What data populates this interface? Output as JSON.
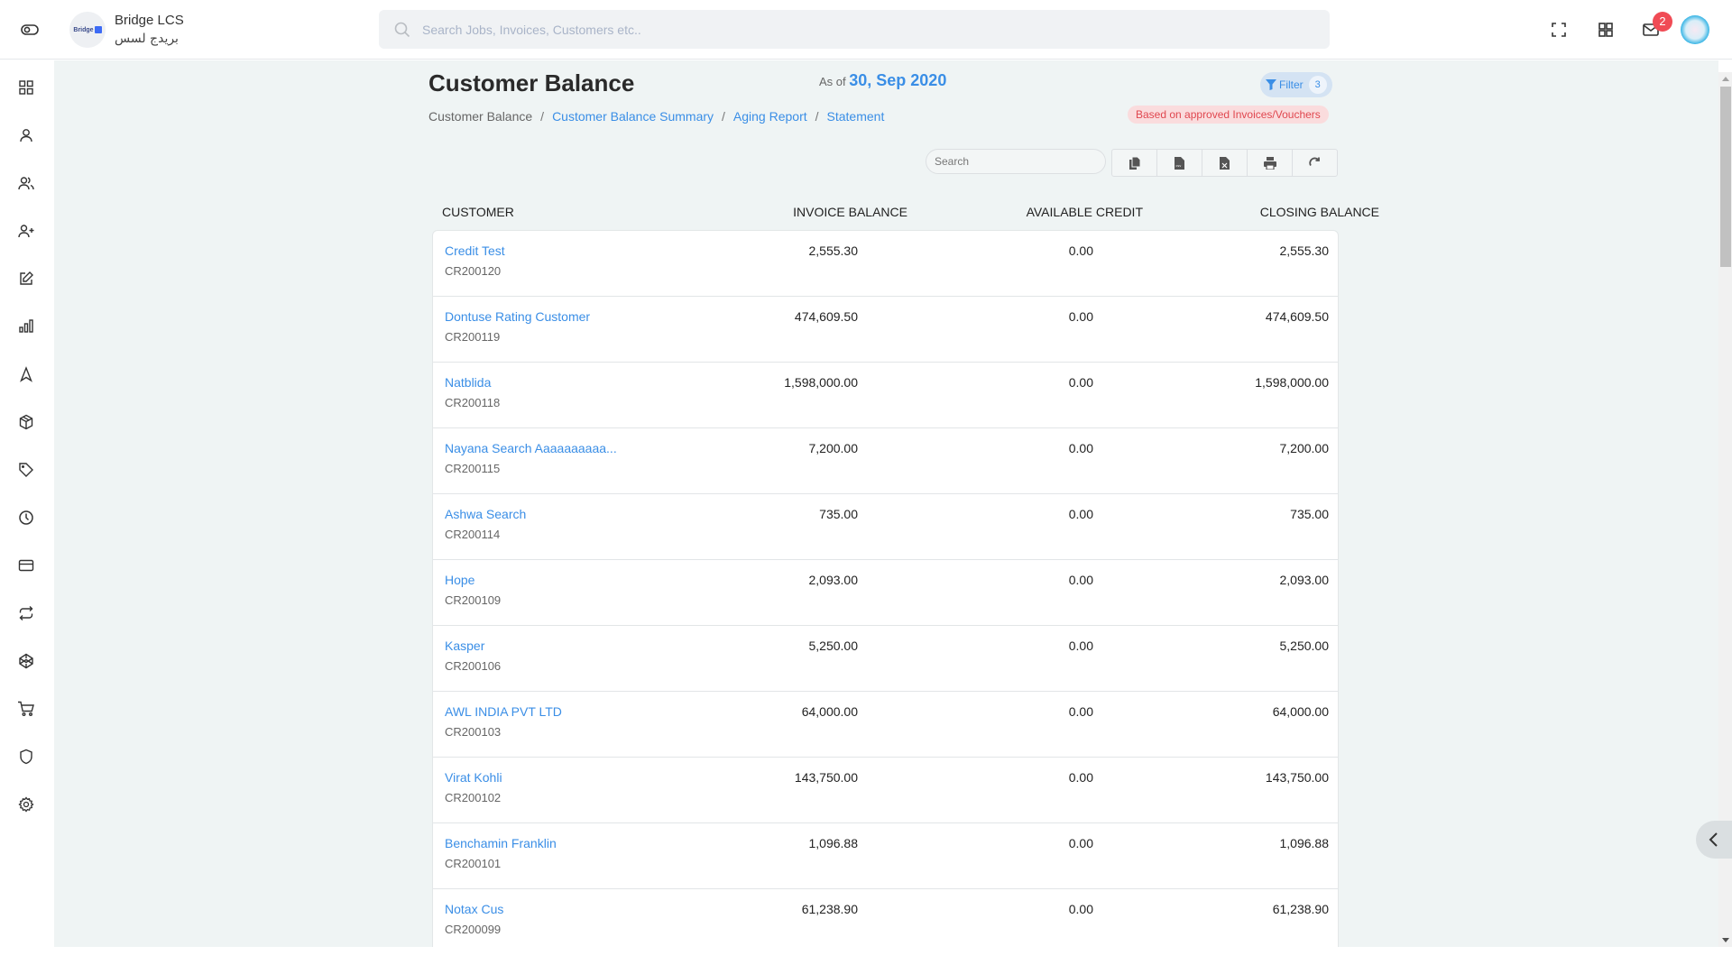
{
  "header": {
    "brand_name": "Bridge LCS",
    "brand_sub": "بريدج لسس",
    "logo_text": "Bridge",
    "search_placeholder": "Search Jobs, Invoices, Customers etc..",
    "notification_count": "2",
    "icons": [
      "toggle-icon",
      "fullscreen-icon",
      "apps-grid-icon",
      "mail-icon",
      "user-avatar"
    ]
  },
  "sidebar": {
    "items": [
      {
        "name": "dashboard",
        "icon": "grid-icon"
      },
      {
        "name": "user",
        "icon": "user-icon"
      },
      {
        "name": "users",
        "icon": "users-icon"
      },
      {
        "name": "add-user",
        "icon": "user-plus-icon"
      },
      {
        "name": "edit",
        "icon": "edit-icon"
      },
      {
        "name": "reports",
        "icon": "bar-chart-icon"
      },
      {
        "name": "navigation",
        "icon": "navigation-icon"
      },
      {
        "name": "packages",
        "icon": "box-icon"
      },
      {
        "name": "tags",
        "icon": "tag-icon"
      },
      {
        "name": "history",
        "icon": "clock-icon"
      },
      {
        "name": "payments",
        "icon": "credit-card-icon"
      },
      {
        "name": "transfers",
        "icon": "repeat-icon"
      },
      {
        "name": "integrations",
        "icon": "codepen-icon"
      },
      {
        "name": "orders",
        "icon": "cart-icon"
      },
      {
        "name": "security",
        "icon": "shield-icon"
      },
      {
        "name": "settings",
        "icon": "gear-icon"
      }
    ]
  },
  "page": {
    "title": "Customer Balance",
    "as_of_label": "As of",
    "as_of_date": "30, Sep 2020",
    "filter_label": "Filter",
    "filter_count": "3",
    "approval_note": "Based on approved Invoices/Vouchers",
    "breadcrumb": {
      "current": "Customer Balance",
      "links": [
        "Customer Balance Summary",
        "Aging Report",
        "Statement"
      ]
    },
    "table_search_placeholder": "Search",
    "tools": [
      "copy-icon",
      "csv-icon",
      "excel-icon",
      "print-icon",
      "refresh-icon"
    ]
  },
  "table": {
    "columns": [
      "CUSTOMER",
      "INVOICE BALANCE",
      "AVAILABLE CREDIT",
      "CLOSING BALANCE"
    ],
    "rows": [
      {
        "name": "Credit Test",
        "code": "CR200120",
        "invoice_balance": "2,555.30",
        "available_credit": "0.00",
        "closing_balance": "2,555.30"
      },
      {
        "name": "Dontuse Rating Customer",
        "code": "CR200119",
        "invoice_balance": "474,609.50",
        "available_credit": "0.00",
        "closing_balance": "474,609.50"
      },
      {
        "name": "Natblida",
        "code": "CR200118",
        "invoice_balance": "1,598,000.00",
        "available_credit": "0.00",
        "closing_balance": "1,598,000.00"
      },
      {
        "name": "Nayana Search Aaaaaaaaaa...",
        "code": "CR200115",
        "invoice_balance": "7,200.00",
        "available_credit": "0.00",
        "closing_balance": "7,200.00"
      },
      {
        "name": "Ashwa Search",
        "code": "CR200114",
        "invoice_balance": "735.00",
        "available_credit": "0.00",
        "closing_balance": "735.00"
      },
      {
        "name": "Hope",
        "code": "CR200109",
        "invoice_balance": "2,093.00",
        "available_credit": "0.00",
        "closing_balance": "2,093.00"
      },
      {
        "name": "Kasper",
        "code": "CR200106",
        "invoice_balance": "5,250.00",
        "available_credit": "0.00",
        "closing_balance": "5,250.00"
      },
      {
        "name": "AWL INDIA PVT LTD",
        "code": "CR200103",
        "invoice_balance": "64,000.00",
        "available_credit": "0.00",
        "closing_balance": "64,000.00"
      },
      {
        "name": "Virat Kohli",
        "code": "CR200102",
        "invoice_balance": "143,750.00",
        "available_credit": "0.00",
        "closing_balance": "143,750.00"
      },
      {
        "name": "Benchamin Franklin",
        "code": "CR200101",
        "invoice_balance": "1,096.88",
        "available_credit": "0.00",
        "closing_balance": "1,096.88"
      },
      {
        "name": "Notax Cus",
        "code": "CR200099",
        "invoice_balance": "61,238.90",
        "available_credit": "0.00",
        "closing_balance": "61,238.90"
      }
    ]
  },
  "colors": {
    "accent": "#3a8ee6",
    "badge": "#f04b55",
    "warning_text": "#e0474f",
    "background": "#eff4f4"
  }
}
